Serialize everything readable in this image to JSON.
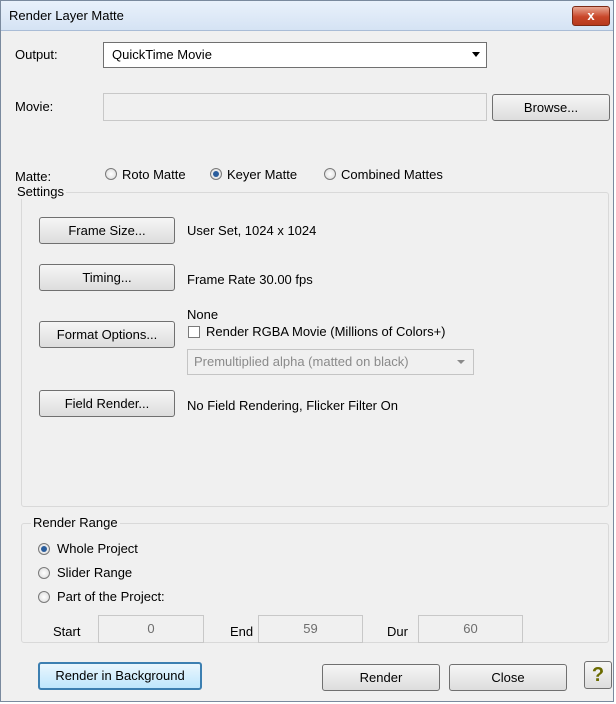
{
  "window": {
    "title": "Render Layer Matte",
    "close_label": "x"
  },
  "output": {
    "label": "Output:",
    "value": "QuickTime Movie"
  },
  "movie": {
    "label": "Movie:",
    "value": "",
    "browse_label": "Browse..."
  },
  "matte": {
    "label": "Matte:",
    "options": [
      "Roto Matte",
      "Keyer Matte",
      "Combined Mattes"
    ],
    "selected": "Keyer Matte"
  },
  "settings": {
    "title": "Settings",
    "frame_size": {
      "button": "Frame Size...",
      "value": "User Set, 1024 x 1024"
    },
    "timing": {
      "button": "Timing...",
      "value": "Frame Rate 30.00 fps"
    },
    "format": {
      "button": "Format Options...",
      "value": "None",
      "rgba_label": "Render RGBA Movie (Millions of Colors+)",
      "rgba_checked": false,
      "alpha_value": "Premultiplied alpha (matted on black)"
    },
    "field_render": {
      "button": "Field Render...",
      "value": "No Field Rendering, Flicker Filter On"
    }
  },
  "render_range": {
    "title": "Render Range",
    "options": [
      "Whole Project",
      "Slider Range",
      "Part of the Project:"
    ],
    "selected": "Whole Project",
    "start_label": "Start",
    "start_value": "0",
    "end_label": "End",
    "end_value": "59",
    "dur_label": "Dur",
    "dur_value": "60"
  },
  "footer": {
    "render_bg_label": "Render in Background",
    "render_label": "Render",
    "close_label": "Close",
    "help_label": "?"
  }
}
